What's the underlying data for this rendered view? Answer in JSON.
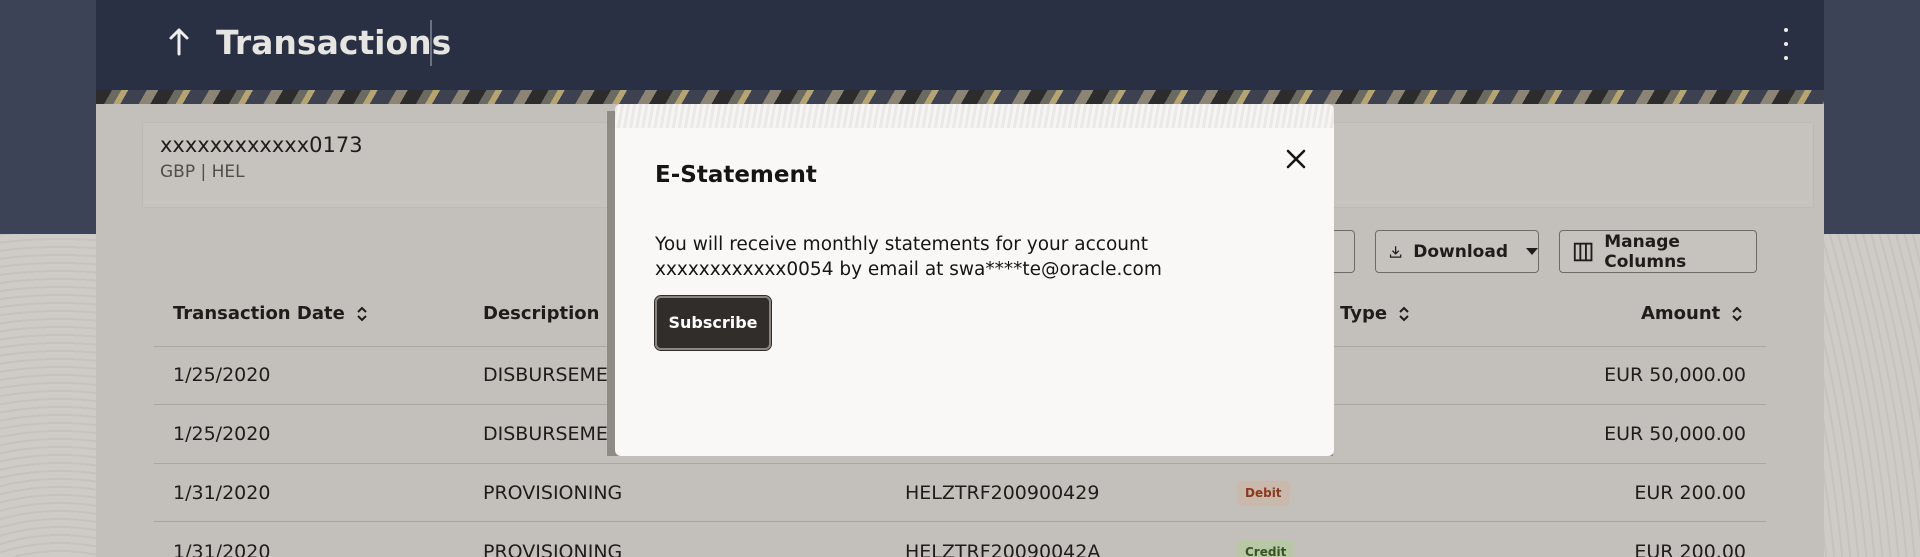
{
  "header": {
    "title": "Transactions",
    "back_icon": "arrow-up-icon",
    "menu_icon": "kebab-menu-icon"
  },
  "account": {
    "number": "xxxxxxxxxxxx0173",
    "sub": "GBP | HEL"
  },
  "toolbar": {
    "download_label": "Download",
    "manage_columns_label": "Manage Columns"
  },
  "table": {
    "headers": {
      "date": "Transaction Date",
      "description": "Description",
      "type": "n Type",
      "amount": "Amount"
    },
    "rows": [
      {
        "date": "1/25/2020",
        "description": "DISBURSEMEN",
        "reference": "",
        "type": "",
        "amount": "EUR 50,000.00"
      },
      {
        "date": "1/25/2020",
        "description": "DISBURSEMEN",
        "reference": "",
        "type": "",
        "amount": "EUR 50,000.00"
      },
      {
        "date": "1/31/2020",
        "description": "PROVISIONING",
        "reference": "HELZTRF200900429",
        "type": "Debit",
        "amount": "EUR 200.00"
      },
      {
        "date": "1/31/2020",
        "description": "PROVISIONING",
        "reference": "HELZTRF20090042A",
        "type": "Credit",
        "amount": "EUR 200.00"
      }
    ]
  },
  "modal": {
    "title": "E-Statement",
    "body": "You will receive monthly statements for your account xxxxxxxxxxxx0054 by email at swa****te@oracle.com",
    "subscribe_label": "Subscribe",
    "close_icon": "close-icon"
  },
  "colors": {
    "header_bg": "#2a3043",
    "accent_button": "#312d2a",
    "debit": "#8a3a1e",
    "credit": "#355520"
  }
}
